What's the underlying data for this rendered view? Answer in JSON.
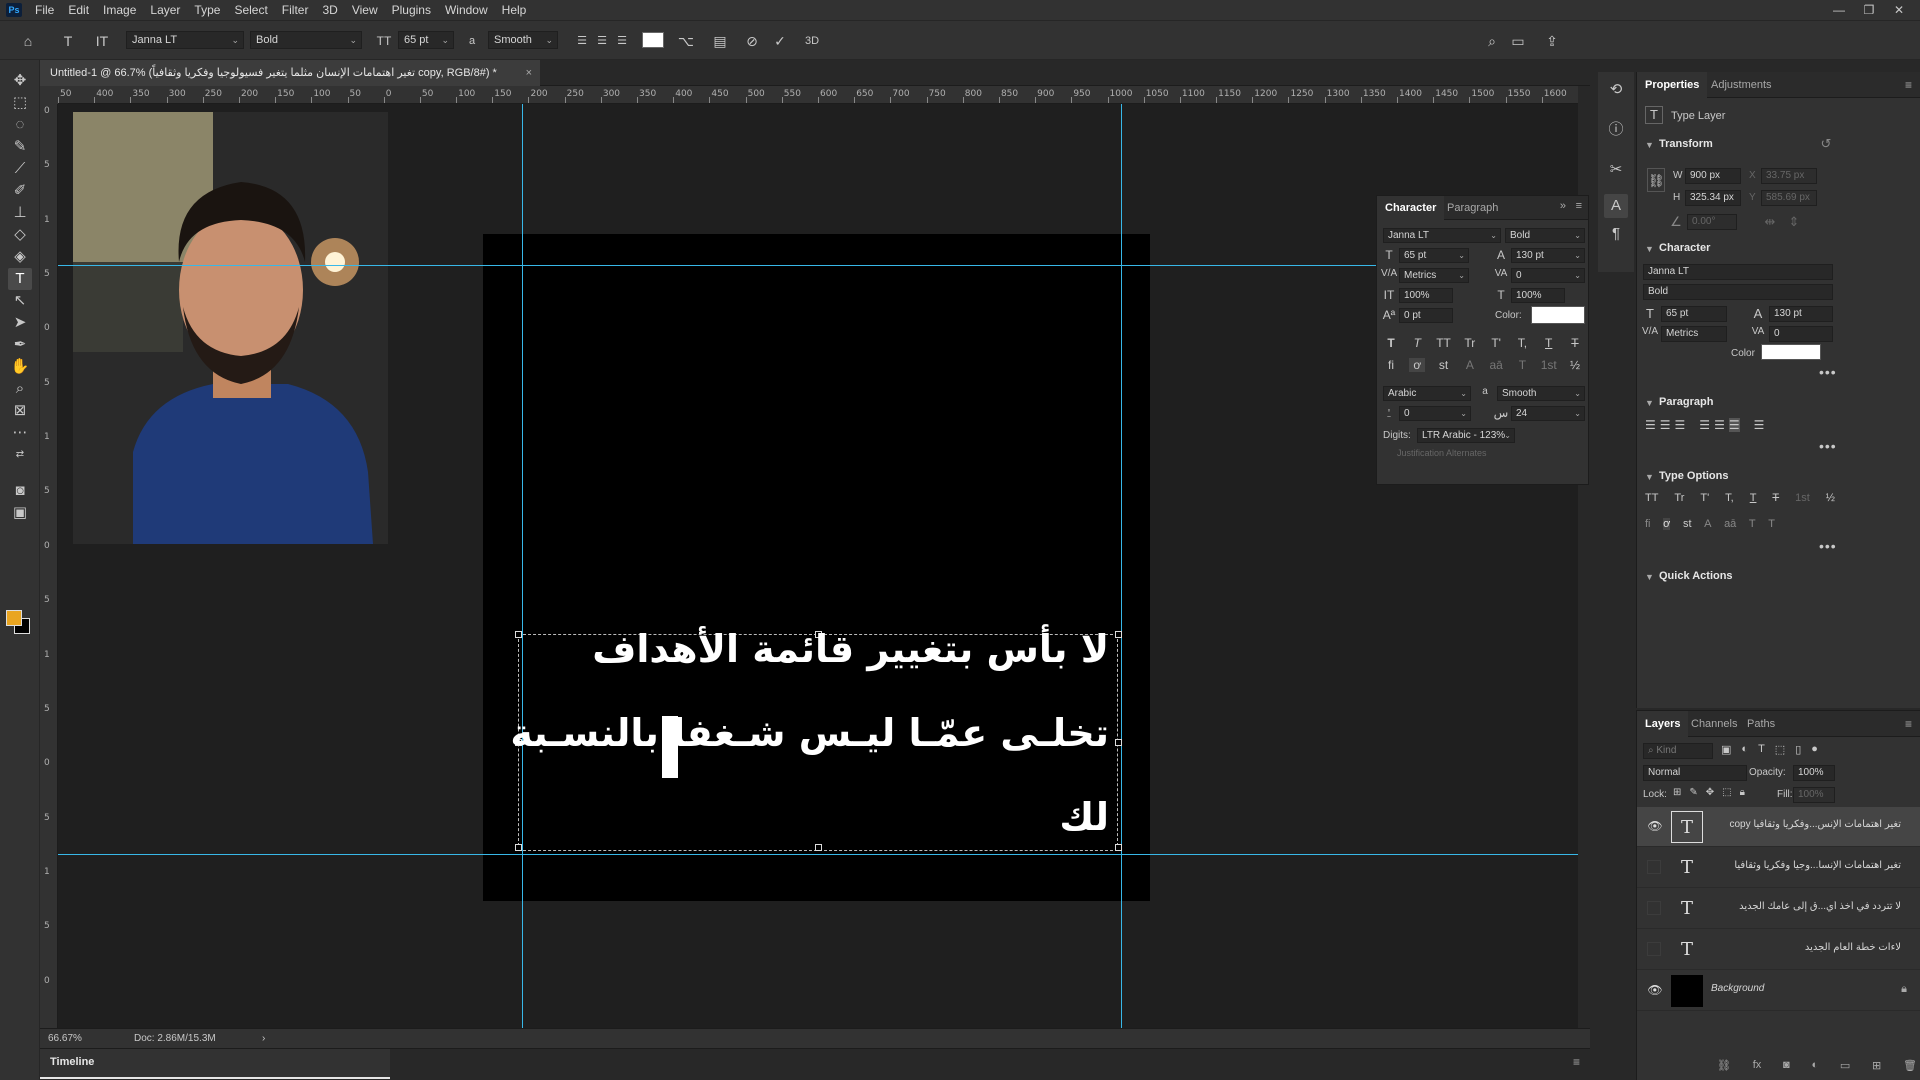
{
  "app": {
    "logo": "Ps"
  },
  "menu": [
    "File",
    "Edit",
    "Image",
    "Layer",
    "Type",
    "Select",
    "Filter",
    "3D",
    "View",
    "Plugins",
    "Window",
    "Help"
  ],
  "window_controls": [
    "—",
    "❐",
    "✕"
  ],
  "options_bar": {
    "font_family": "Janna LT",
    "font_style": "Bold",
    "font_size": "65 pt",
    "aa_label": "a",
    "antialias": "Smooth",
    "text_color": "#ffffff"
  },
  "document": {
    "tab_title": "Untitled-1 @ 66.7% (تغير اهتمامات الإنسان مثلما يتغير فسيولوجيا وفكريا وثقافياً copy, RGB/8#) *",
    "close": "×"
  },
  "ruler": {
    "top_ticks": [
      "50",
      "400",
      "350",
      "300",
      "250",
      "200",
      "150",
      "100",
      "50",
      "0",
      "50",
      "100",
      "150",
      "200",
      "250",
      "300",
      "350",
      "400",
      "450",
      "500",
      "550",
      "600",
      "650",
      "700",
      "750",
      "800",
      "850",
      "900",
      "950",
      "1000",
      "1050",
      "1100",
      "1150",
      "1200",
      "1250",
      "1300",
      "1350",
      "1400",
      "1450",
      "1500",
      "1550",
      "1600"
    ],
    "left_ticks": [
      "0",
      "5",
      "1",
      "5",
      "0",
      "5",
      "1",
      "5",
      "0",
      "5",
      "1",
      "5",
      "0",
      "5",
      "1",
      "5",
      "0"
    ]
  },
  "canvas": {
    "text_lines": [
      "لا بأس بتغيير قائمة الأهداف",
      "تخلـى عمّـا ليـس شـغفا بالنسـبة",
      "لك"
    ]
  },
  "status": {
    "zoom": "66.67%",
    "doc": "Doc: 2.86M/15.3M",
    "arrow": "›"
  },
  "timeline": {
    "tab": "Timeline"
  },
  "character_panel": {
    "tabs": [
      "Character",
      "Paragraph"
    ],
    "font_family": "Janna LT",
    "font_style": "Bold",
    "size": "65 pt",
    "leading": "130 pt",
    "kerning": "Metrics",
    "tracking": "0",
    "vscale": "100%",
    "hscale": "100%",
    "baseline": "0 pt",
    "color_label": "Color:",
    "text_color": "#ffffff",
    "language": "Arabic",
    "aa_label": "a",
    "antialias": "Smooth",
    "kashida_left": "0",
    "kashida_right": "24",
    "digits_label": "Digits:",
    "digits_value": "LTR Arabic - 123%",
    "justification": "Justification Alternates",
    "type_buttons": [
      "T",
      "T",
      "TT",
      "Tr",
      "T'",
      "T,",
      "T",
      "T"
    ],
    "opentype_buttons": [
      "fi",
      "ơ",
      "st",
      "A",
      "aā",
      "T",
      "1st",
      "½"
    ]
  },
  "properties_panel": {
    "tabs": [
      "Properties",
      "Adjustments"
    ],
    "layer_type": "Type Layer",
    "transform_title": "Transform",
    "w_label": "W",
    "w_value": "900 px",
    "h_label": "H",
    "h_value": "325.34 px",
    "x_label": "X",
    "x_value": "33.75 px",
    "y_label": "Y",
    "y_value": "585.69 px",
    "angle_value": "0.00°",
    "character_title": "Character",
    "font_family": "Janna LT",
    "font_style": "Bold",
    "size": "65 pt",
    "leading": "130 pt",
    "kerning": "Metrics",
    "tracking": "0",
    "color_label": "Color",
    "text_color": "#ffffff",
    "paragraph_title": "Paragraph",
    "type_options_title": "Type Options",
    "type_options_row1": [
      "TT",
      "Tr",
      "T'",
      "T,",
      "T",
      "T",
      "1st",
      "½"
    ],
    "type_options_row2": [
      "fi",
      "ơ",
      "st",
      "A",
      "aā",
      "T",
      "T"
    ],
    "quick_actions_title": "Quick Actions",
    "more": "•••"
  },
  "layers_panel": {
    "tabs": [
      "Layers",
      "Channels",
      "Paths"
    ],
    "filter_placeholder": "Kind",
    "blend_mode": "Normal",
    "opacity_label": "Opacity:",
    "opacity_value": "100%",
    "lock_label": "Lock:",
    "fill_label": "Fill:",
    "fill_value": "100%",
    "layers": [
      {
        "name": "تغير اهتمامات الإنس...وفكريا وثقافياً copy",
        "visible": true,
        "selected": true,
        "type": "text"
      },
      {
        "name": "تغير اهتمامات الإنسا...وجيا وفكريا وثقافياً",
        "visible": false,
        "selected": false,
        "type": "text"
      },
      {
        "name": "لا تتردد في أخذ أي...ق إلى عامك الجديد",
        "visible": false,
        "selected": false,
        "type": "text"
      },
      {
        "name": "لاءات خطة العام الجديد",
        "visible": false,
        "selected": false,
        "type": "text"
      },
      {
        "name": "Background",
        "visible": true,
        "selected": false,
        "type": "background"
      }
    ]
  }
}
